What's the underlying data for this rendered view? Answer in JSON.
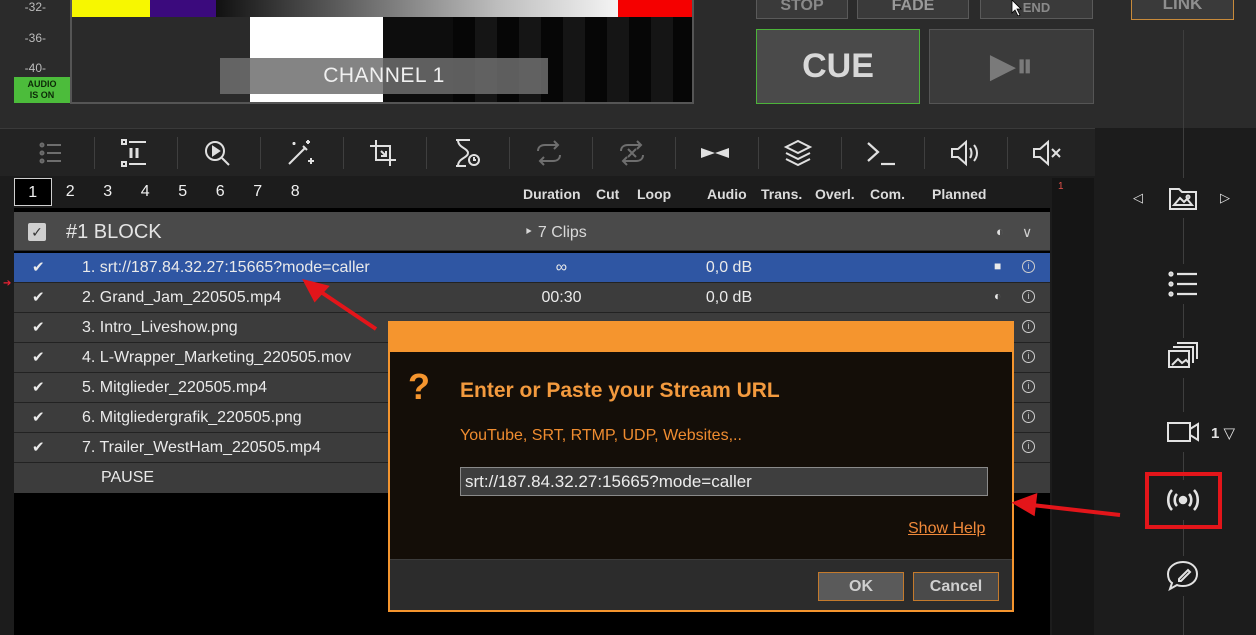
{
  "meter": {
    "db_marks": [
      "-32-",
      "-36-",
      "-40-"
    ],
    "audio_badge_line1": "AUDIO",
    "audio_badge_line2": "IS ON"
  },
  "preview": {
    "channel_label": "CHANNEL 1",
    "bar_colors": [
      "#f7f700",
      "#3b0a7d",
      "#ffffff",
      "#f50000"
    ]
  },
  "playout": {
    "stop_label": "STOP",
    "fade_label": "FADE",
    "end_label": "END",
    "cue_label": "CUE",
    "play_pause_label": "▶⏸",
    "link_label": "LINK",
    "cue_border_color": "#4cb33a"
  },
  "toolbar": {
    "icons": [
      "list-icon",
      "pause-list-icon",
      "search-play-icon",
      "magic-wand-icon",
      "crop-icon",
      "hourglass-icon",
      "loop-icon",
      "loop-off-icon",
      "transition-icon",
      "layers-icon",
      "command-icon",
      "volume-icon",
      "mute-icon"
    ]
  },
  "tabs": [
    "1",
    "2",
    "3",
    "4",
    "5",
    "6",
    "7",
    "8"
  ],
  "columns": {
    "duration": "Duration",
    "cut": "Cut",
    "loop": "Loop",
    "audio": "Audio",
    "trans": "Trans.",
    "overl": "Overl.",
    "com": "Com.",
    "planned": "Planned"
  },
  "block": {
    "check": "✓",
    "title": "#1  BLOCK",
    "clips": "‣ 7 Clips",
    "half_icon": "◐",
    "chevron": "∨"
  },
  "rows": [
    {
      "check": "✔",
      "name": "1. srt://187.84.32.27:15665?mode=caller",
      "duration": "∞",
      "audio": "0,0 dB",
      "planned": "■",
      "info": "i"
    },
    {
      "check": "✔",
      "name": "2. Grand_Jam_220505.mp4",
      "duration": "00:30",
      "audio": "0,0 dB",
      "planned": "◐",
      "info": "i"
    },
    {
      "check": "✔",
      "name": "3. Intro_Liveshow.png",
      "duration": "",
      "audio": "",
      "planned": "",
      "info": "i"
    },
    {
      "check": "✔",
      "name": "4. L-Wrapper_Marketing_220505.mov",
      "duration": "",
      "audio": "",
      "planned": "",
      "info": "i"
    },
    {
      "check": "✔",
      "name": "5. Mitglieder_220505.mp4",
      "duration": "",
      "audio": "",
      "planned": "",
      "info": "i"
    },
    {
      "check": "✔",
      "name": "6. Mitgliedergrafik_220505.png",
      "duration": "",
      "audio": "",
      "planned": "",
      "info": "i"
    },
    {
      "check": "✔",
      "name": "7. Trailer_WestHam_220505.mp4",
      "duration": "",
      "audio": "",
      "planned": "",
      "info": "i"
    }
  ],
  "pause_row": "PAUSE",
  "timeline_marker": "1",
  "sidebar": {
    "prev": "◁",
    "next": "▷",
    "camera_number": "1 ▽",
    "items": [
      "image-folder-icon",
      "playlist-icon",
      "media-icon",
      "camera-icon",
      "stream-icon",
      "chat-icon"
    ]
  },
  "dialog": {
    "question_mark": "?",
    "title": "Enter or Paste your Stream URL",
    "subtitle": "YouTube, SRT, RTMP, UDP, Websites,..",
    "url_value": "srt://187.84.32.27:15665?mode=caller",
    "show_help": "Show Help",
    "ok": "OK",
    "cancel": "Cancel",
    "accent_color": "#f5952e"
  }
}
